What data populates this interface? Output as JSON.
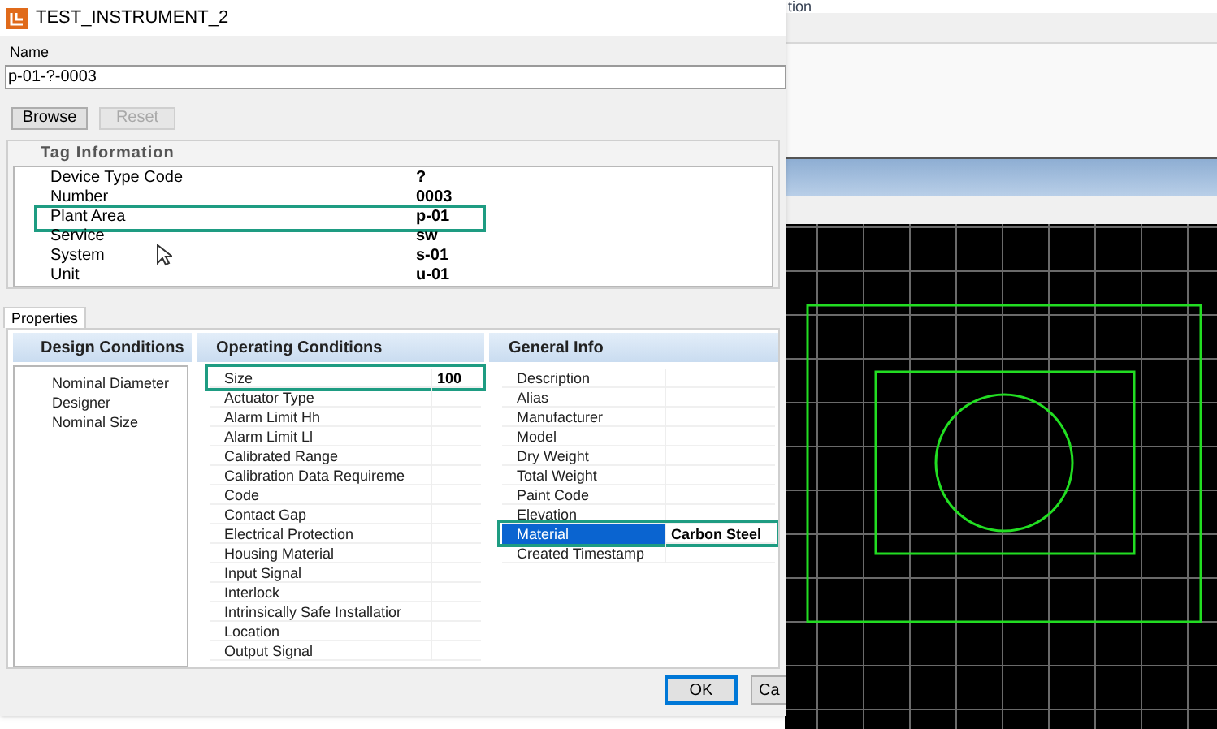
{
  "background_app": {
    "header_text": "tion"
  },
  "dialog": {
    "title": "TEST_INSTRUMENT_2",
    "name_label": "Name",
    "name_value": "p-01-?-0003",
    "buttons": [
      {
        "label": "Browse",
        "disabled": false
      },
      {
        "label": "Reset",
        "disabled": true
      }
    ],
    "tag_information": {
      "title": "Tag Information",
      "rows": [
        {
          "label": "Device Type Code",
          "value": "?",
          "highlighted": false
        },
        {
          "label": "Number",
          "value": "0003",
          "highlighted": false
        },
        {
          "label": "Plant Area",
          "value": "p-01",
          "highlighted": true
        },
        {
          "label": "Service",
          "value": "sw",
          "highlighted": false
        },
        {
          "label": "System",
          "value": "s-01",
          "highlighted": false
        },
        {
          "label": "Unit",
          "value": "u-01",
          "highlighted": false
        }
      ]
    },
    "tabs": [
      {
        "label": "Properties",
        "selected": true
      }
    ],
    "columns": [
      {
        "title": "Design Conditions",
        "rows": [
          {
            "label": "Nominal Diameter",
            "selected": false,
            "highlighted": false
          },
          {
            "label": "Designer",
            "selected": false,
            "highlighted": false
          },
          {
            "label": "Nominal Size",
            "selected": false,
            "highlighted": false
          }
        ]
      },
      {
        "title": "Operating Conditions",
        "rows": [
          {
            "label": "Size",
            "value": "100",
            "selected": false,
            "highlighted": true
          },
          {
            "label": "Actuator Type",
            "selected": false,
            "highlighted": false
          },
          {
            "label": "Alarm Limit Hh",
            "selected": false,
            "highlighted": false
          },
          {
            "label": "Alarm Limit Ll",
            "selected": false,
            "highlighted": false
          },
          {
            "label": "Calibrated Range",
            "selected": false,
            "highlighted": false
          },
          {
            "label": "Calibration Data Requireme",
            "selected": false,
            "highlighted": false
          },
          {
            "label": "Code",
            "selected": false,
            "highlighted": false
          },
          {
            "label": "Contact Gap",
            "selected": false,
            "highlighted": false
          },
          {
            "label": "Electrical Protection",
            "selected": false,
            "highlighted": false
          },
          {
            "label": "Housing Material",
            "selected": false,
            "highlighted": false
          },
          {
            "label": "Input Signal",
            "selected": false,
            "highlighted": false
          },
          {
            "label": "Interlock",
            "selected": false,
            "highlighted": false
          },
          {
            "label": "Intrinsically Safe Installatior",
            "selected": false,
            "highlighted": false
          },
          {
            "label": "Location",
            "selected": false,
            "highlighted": false
          },
          {
            "label": "Output Signal",
            "selected": false,
            "highlighted": false
          }
        ]
      },
      {
        "title": "General Info",
        "rows": [
          {
            "label": "Description",
            "selected": false,
            "highlighted": false
          },
          {
            "label": "Alias",
            "selected": false,
            "highlighted": false
          },
          {
            "label": "Manufacturer",
            "selected": false,
            "highlighted": false
          },
          {
            "label": "Model",
            "selected": false,
            "highlighted": false
          },
          {
            "label": "Dry Weight",
            "selected": false,
            "highlighted": false
          },
          {
            "label": "Total Weight",
            "selected": false,
            "highlighted": false
          },
          {
            "label": "Paint Code",
            "selected": false,
            "highlighted": false
          },
          {
            "label": "Elevation",
            "selected": false,
            "highlighted": false
          },
          {
            "label": "Material",
            "value": "Carbon Steel",
            "selected": true,
            "highlighted": true
          },
          {
            "label": "Created Timestamp",
            "selected": false,
            "highlighted": false
          }
        ]
      }
    ],
    "footer_buttons": [
      "OK",
      "Ca"
    ]
  }
}
